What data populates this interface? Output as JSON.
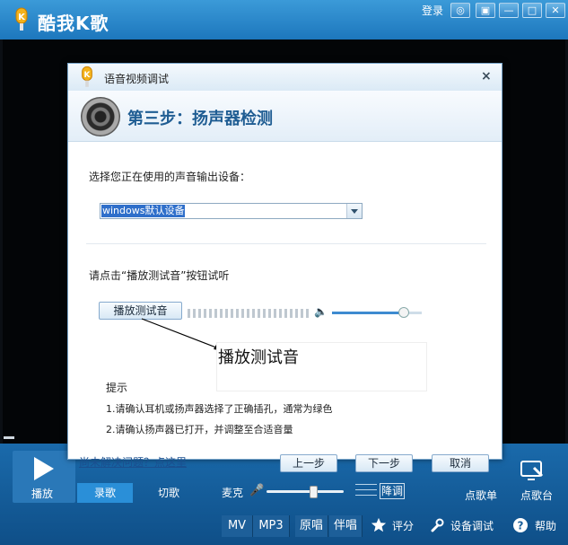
{
  "app": {
    "title": "酷我K歌",
    "login": "登录"
  },
  "window_controls": [
    "◎",
    "▣",
    "—",
    "□",
    "✕"
  ],
  "dialog": {
    "title": "语音视频调试",
    "close": "×",
    "step_title": "第三步：扬声器检测",
    "device_label": "选择您正在使用的声音输出设备：",
    "device_value": "windows默认设备",
    "test_prompt": "请点击“播放测试音”按钮试听",
    "play_test_button": "播放测试音",
    "tooltip": "播放测试音",
    "hint_title": "提示",
    "hints": [
      "1.请确认耳机或扬声器选择了正确插孔，通常为绿色",
      "2.请确认扬声器已打开，并调整至合适音量"
    ],
    "help_link": "尚未解决问题？点这里",
    "prev_button": "上一步",
    "next_button": "下一步",
    "cancel_button": "取消"
  },
  "controls": {
    "play": "播放",
    "record": "录歌",
    "cut": "切歌",
    "mic": "麦克",
    "pitch_down": "降调",
    "song_list": "点歌单",
    "song_station": "点歌台",
    "tabs": [
      "MV",
      "MP3",
      "原唱",
      "伴唱"
    ],
    "rate": "评分",
    "device_debug": "设备调试",
    "help": "帮助"
  },
  "colors": {
    "brand_blue": "#1d77bd",
    "step_title": "#1f5d93"
  }
}
